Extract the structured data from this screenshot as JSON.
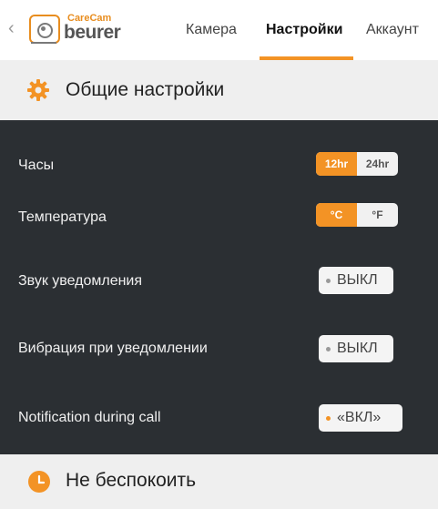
{
  "header": {
    "back_glyph": "‹",
    "logo_small": "CareCam",
    "logo_large": "beurer",
    "tabs": [
      {
        "label": "Камера"
      },
      {
        "label": "Настройки"
      },
      {
        "label": "Аккаунт"
      }
    ],
    "active_tab": "Настройки",
    "accent_color": "#f39325"
  },
  "general": {
    "title": "Общие настройки",
    "icon": "gear-icon"
  },
  "settings": {
    "clock": {
      "label": "Часы",
      "options": [
        "12hr",
        "24hr"
      ],
      "selected": "12hr"
    },
    "temperature": {
      "label": "Температура",
      "options": [
        "°C",
        "°F"
      ],
      "selected": "°C"
    },
    "notification_sound": {
      "label": "Звук уведомления",
      "state": "ВЫКЛ"
    },
    "notification_vibration": {
      "label": "Вибрация при уведомлении",
      "state": "ВЫКЛ"
    },
    "notification_during_call": {
      "label": "Notification during call",
      "state": "«ВКЛ»"
    }
  },
  "do_not_disturb": {
    "title": "Не беспокоить",
    "icon": "clock-icon"
  }
}
